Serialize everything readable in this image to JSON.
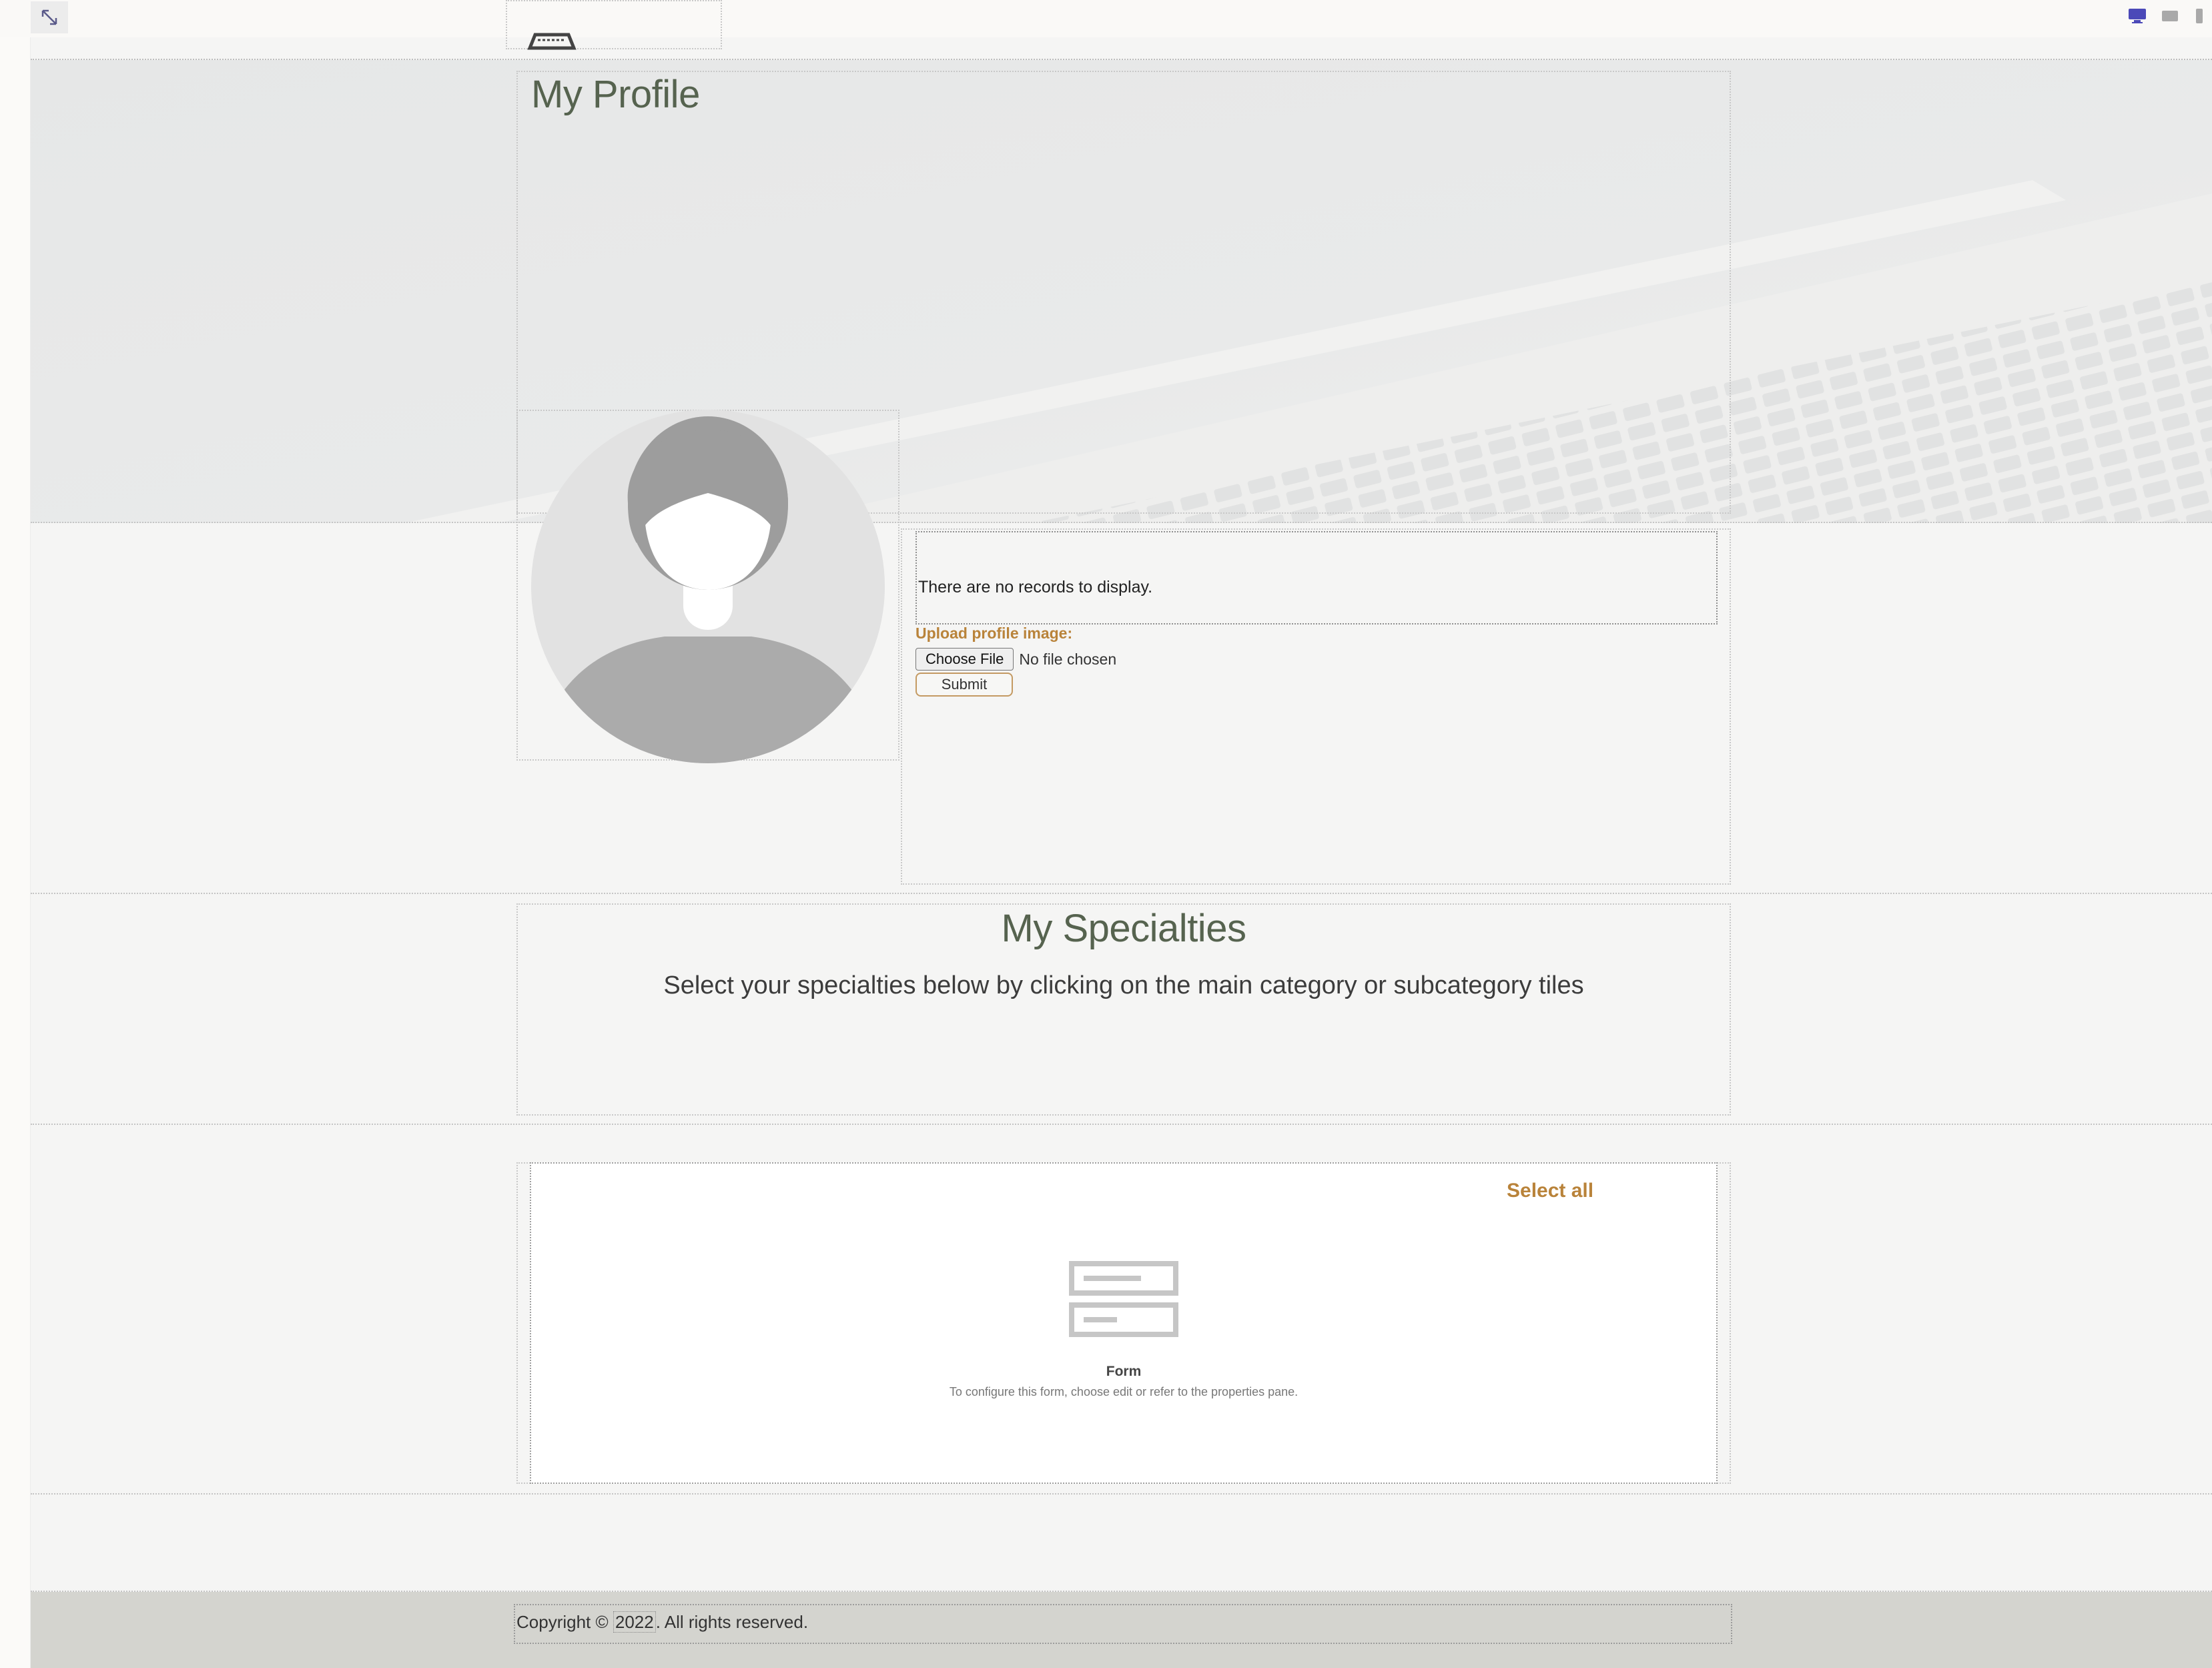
{
  "page": {
    "title": "My Profile",
    "colors": {
      "heading": "#56634f",
      "accent": "#b9833a",
      "footer_bg": "#d4d4cf",
      "hero_bg": "#e7e8e8"
    }
  },
  "toolbar": {
    "expand_icon": "expand-icon",
    "devices": [
      {
        "name": "desktop-icon",
        "active": true
      },
      {
        "name": "tablet-icon",
        "active": false
      },
      {
        "name": "mobile-icon",
        "active": false
      }
    ]
  },
  "profile": {
    "records_message": "There are no records to display.",
    "upload_label": "Upload profile image:",
    "choose_file_label": "Choose File",
    "file_status": "No file chosen",
    "submit_label": "Submit"
  },
  "specialties": {
    "title": "My Specialties",
    "subtitle": "Select your specialties below by clicking on the main category or subcategory tiles",
    "select_all_label": "Select all",
    "form_placeholder_title": "Form",
    "form_placeholder_hint": "To configure this form, choose edit or refer to the properties pane."
  },
  "footer": {
    "copyright_prefix": "Copyright © ",
    "year": "2022",
    "copyright_suffix": ". All rights reserved."
  }
}
